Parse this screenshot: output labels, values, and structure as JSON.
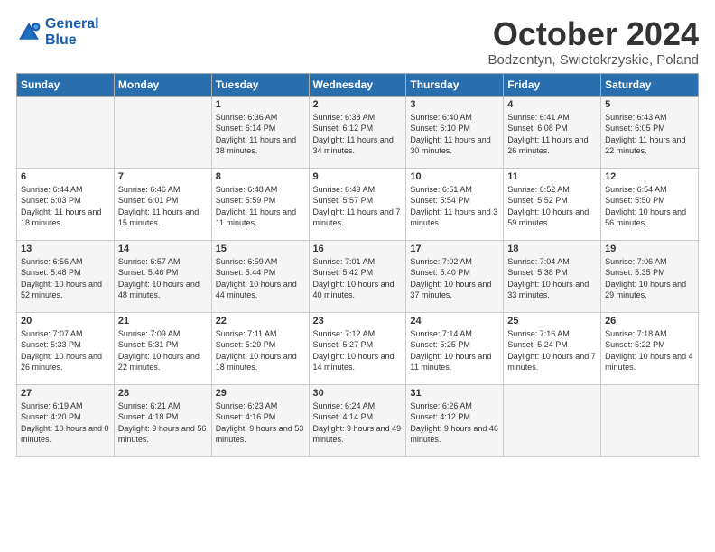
{
  "header": {
    "logo_line1": "General",
    "logo_line2": "Blue",
    "title": "October 2024",
    "subtitle": "Bodzentyn, Swietokrzyskie, Poland"
  },
  "weekdays": [
    "Sunday",
    "Monday",
    "Tuesday",
    "Wednesday",
    "Thursday",
    "Friday",
    "Saturday"
  ],
  "weeks": [
    [
      {
        "day": "",
        "info": ""
      },
      {
        "day": "",
        "info": ""
      },
      {
        "day": "1",
        "info": "Sunrise: 6:36 AM\nSunset: 6:14 PM\nDaylight: 11 hours and 38 minutes."
      },
      {
        "day": "2",
        "info": "Sunrise: 6:38 AM\nSunset: 6:12 PM\nDaylight: 11 hours and 34 minutes."
      },
      {
        "day": "3",
        "info": "Sunrise: 6:40 AM\nSunset: 6:10 PM\nDaylight: 11 hours and 30 minutes."
      },
      {
        "day": "4",
        "info": "Sunrise: 6:41 AM\nSunset: 6:08 PM\nDaylight: 11 hours and 26 minutes."
      },
      {
        "day": "5",
        "info": "Sunrise: 6:43 AM\nSunset: 6:05 PM\nDaylight: 11 hours and 22 minutes."
      }
    ],
    [
      {
        "day": "6",
        "info": "Sunrise: 6:44 AM\nSunset: 6:03 PM\nDaylight: 11 hours and 18 minutes."
      },
      {
        "day": "7",
        "info": "Sunrise: 6:46 AM\nSunset: 6:01 PM\nDaylight: 11 hours and 15 minutes."
      },
      {
        "day": "8",
        "info": "Sunrise: 6:48 AM\nSunset: 5:59 PM\nDaylight: 11 hours and 11 minutes."
      },
      {
        "day": "9",
        "info": "Sunrise: 6:49 AM\nSunset: 5:57 PM\nDaylight: 11 hours and 7 minutes."
      },
      {
        "day": "10",
        "info": "Sunrise: 6:51 AM\nSunset: 5:54 PM\nDaylight: 11 hours and 3 minutes."
      },
      {
        "day": "11",
        "info": "Sunrise: 6:52 AM\nSunset: 5:52 PM\nDaylight: 10 hours and 59 minutes."
      },
      {
        "day": "12",
        "info": "Sunrise: 6:54 AM\nSunset: 5:50 PM\nDaylight: 10 hours and 56 minutes."
      }
    ],
    [
      {
        "day": "13",
        "info": "Sunrise: 6:56 AM\nSunset: 5:48 PM\nDaylight: 10 hours and 52 minutes."
      },
      {
        "day": "14",
        "info": "Sunrise: 6:57 AM\nSunset: 5:46 PM\nDaylight: 10 hours and 48 minutes."
      },
      {
        "day": "15",
        "info": "Sunrise: 6:59 AM\nSunset: 5:44 PM\nDaylight: 10 hours and 44 minutes."
      },
      {
        "day": "16",
        "info": "Sunrise: 7:01 AM\nSunset: 5:42 PM\nDaylight: 10 hours and 40 minutes."
      },
      {
        "day": "17",
        "info": "Sunrise: 7:02 AM\nSunset: 5:40 PM\nDaylight: 10 hours and 37 minutes."
      },
      {
        "day": "18",
        "info": "Sunrise: 7:04 AM\nSunset: 5:38 PM\nDaylight: 10 hours and 33 minutes."
      },
      {
        "day": "19",
        "info": "Sunrise: 7:06 AM\nSunset: 5:35 PM\nDaylight: 10 hours and 29 minutes."
      }
    ],
    [
      {
        "day": "20",
        "info": "Sunrise: 7:07 AM\nSunset: 5:33 PM\nDaylight: 10 hours and 26 minutes."
      },
      {
        "day": "21",
        "info": "Sunrise: 7:09 AM\nSunset: 5:31 PM\nDaylight: 10 hours and 22 minutes."
      },
      {
        "day": "22",
        "info": "Sunrise: 7:11 AM\nSunset: 5:29 PM\nDaylight: 10 hours and 18 minutes."
      },
      {
        "day": "23",
        "info": "Sunrise: 7:12 AM\nSunset: 5:27 PM\nDaylight: 10 hours and 14 minutes."
      },
      {
        "day": "24",
        "info": "Sunrise: 7:14 AM\nSunset: 5:25 PM\nDaylight: 10 hours and 11 minutes."
      },
      {
        "day": "25",
        "info": "Sunrise: 7:16 AM\nSunset: 5:24 PM\nDaylight: 10 hours and 7 minutes."
      },
      {
        "day": "26",
        "info": "Sunrise: 7:18 AM\nSunset: 5:22 PM\nDaylight: 10 hours and 4 minutes."
      }
    ],
    [
      {
        "day": "27",
        "info": "Sunrise: 6:19 AM\nSunset: 4:20 PM\nDaylight: 10 hours and 0 minutes."
      },
      {
        "day": "28",
        "info": "Sunrise: 6:21 AM\nSunset: 4:18 PM\nDaylight: 9 hours and 56 minutes."
      },
      {
        "day": "29",
        "info": "Sunrise: 6:23 AM\nSunset: 4:16 PM\nDaylight: 9 hours and 53 minutes."
      },
      {
        "day": "30",
        "info": "Sunrise: 6:24 AM\nSunset: 4:14 PM\nDaylight: 9 hours and 49 minutes."
      },
      {
        "day": "31",
        "info": "Sunrise: 6:26 AM\nSunset: 4:12 PM\nDaylight: 9 hours and 46 minutes."
      },
      {
        "day": "",
        "info": ""
      },
      {
        "day": "",
        "info": ""
      }
    ]
  ]
}
